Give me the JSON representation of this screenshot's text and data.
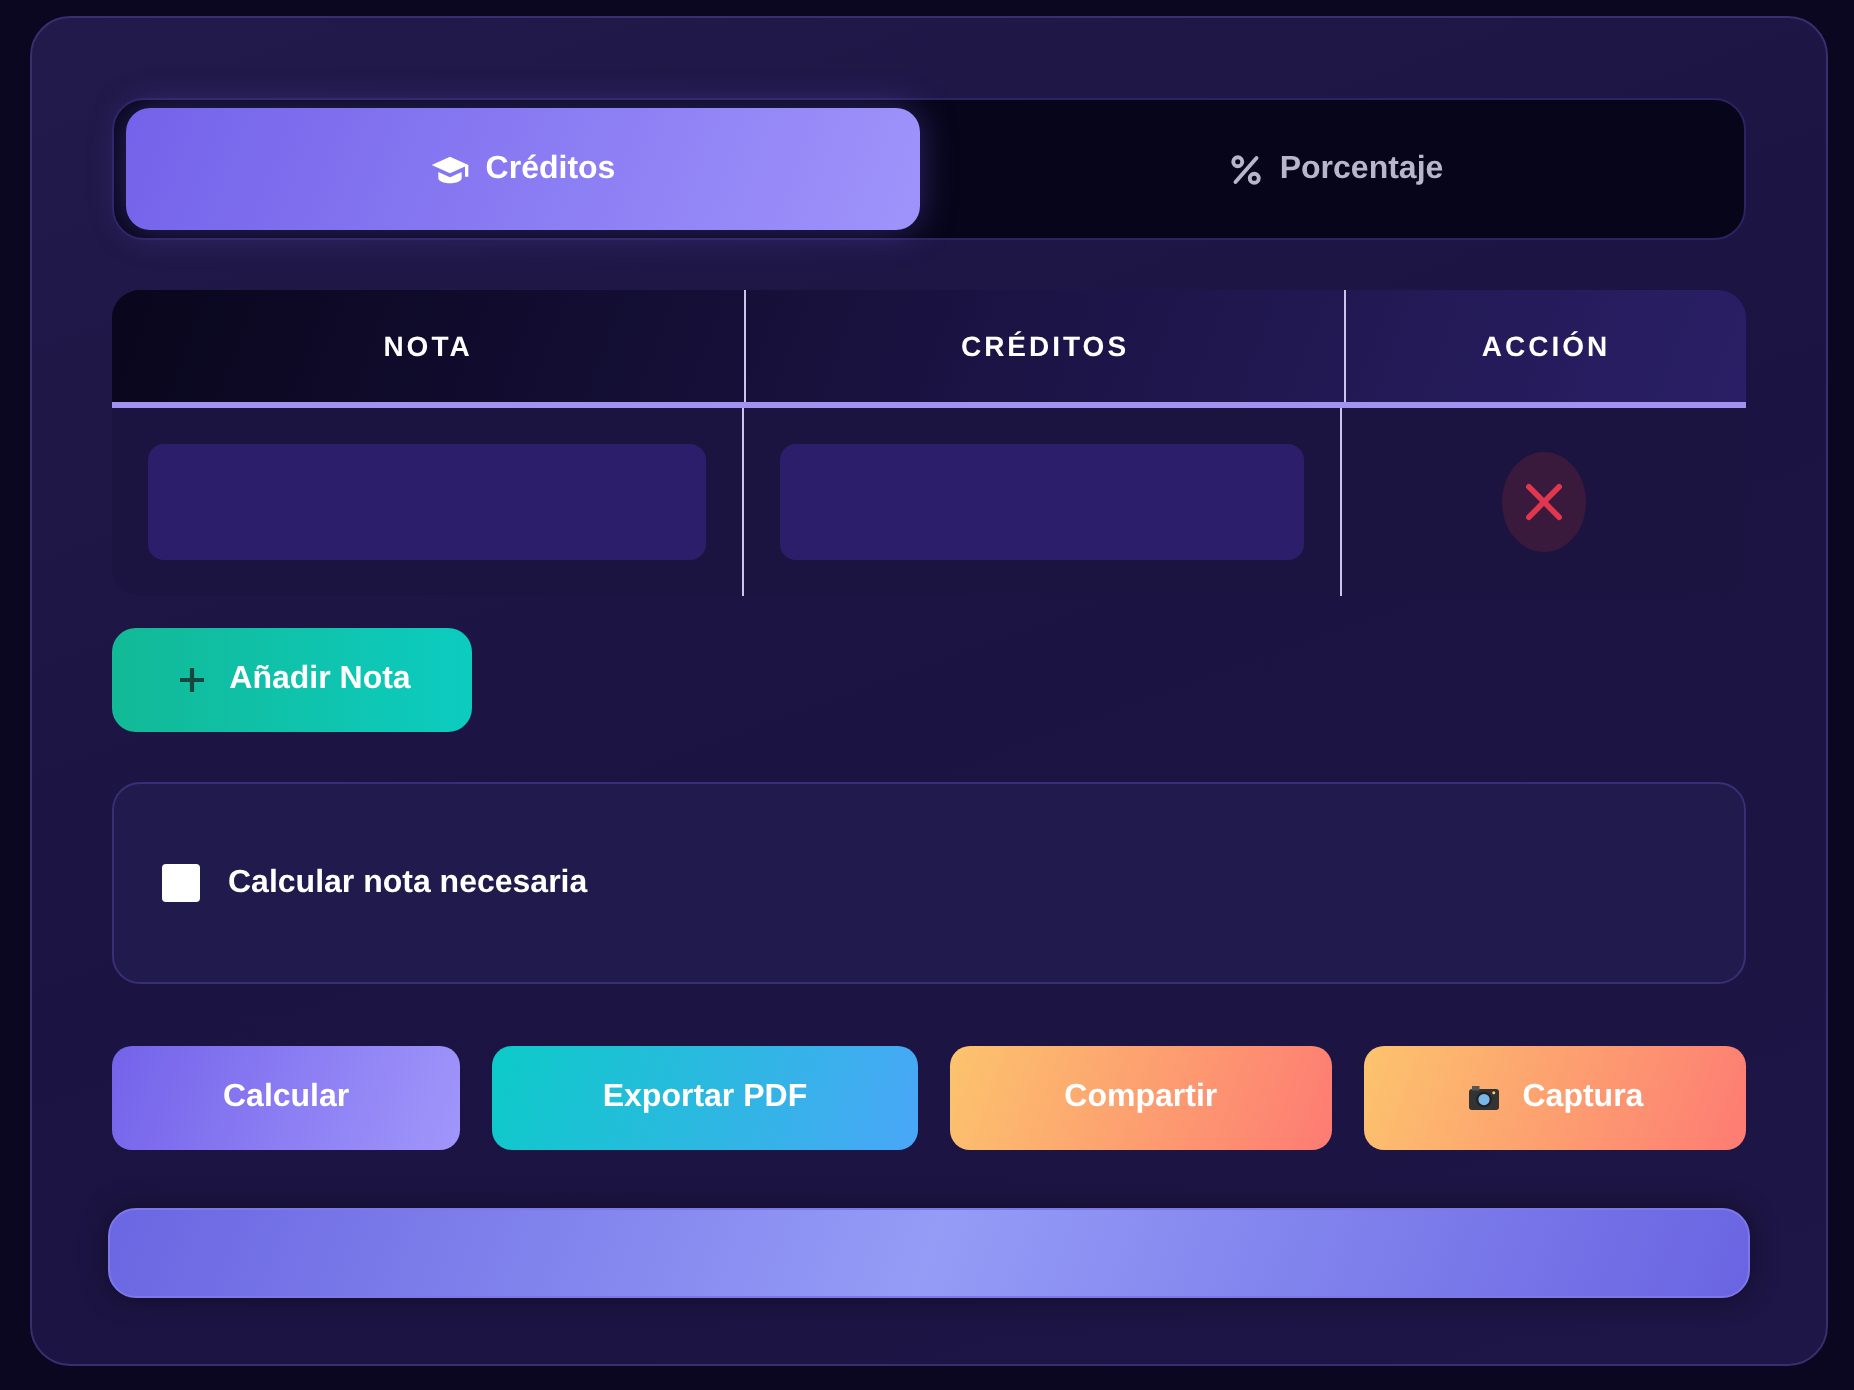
{
  "tabs": [
    {
      "label": "Créditos",
      "selected": true
    },
    {
      "label": "Porcentaje",
      "selected": false
    }
  ],
  "table": {
    "columns": [
      "NOTA",
      "CRÉDITOS",
      "ACCIÓN"
    ]
  },
  "add_button": "Añadir Nota",
  "option": {
    "label": "Calcular nota necesaria",
    "checked": false
  },
  "actions": [
    {
      "label": "Calcular",
      "kind": "primary"
    },
    {
      "label": "Exportar PDF",
      "kind": "info"
    },
    {
      "label": "Compartir",
      "kind": "warm"
    },
    {
      "label": "Captura",
      "kind": "warm"
    }
  ]
}
